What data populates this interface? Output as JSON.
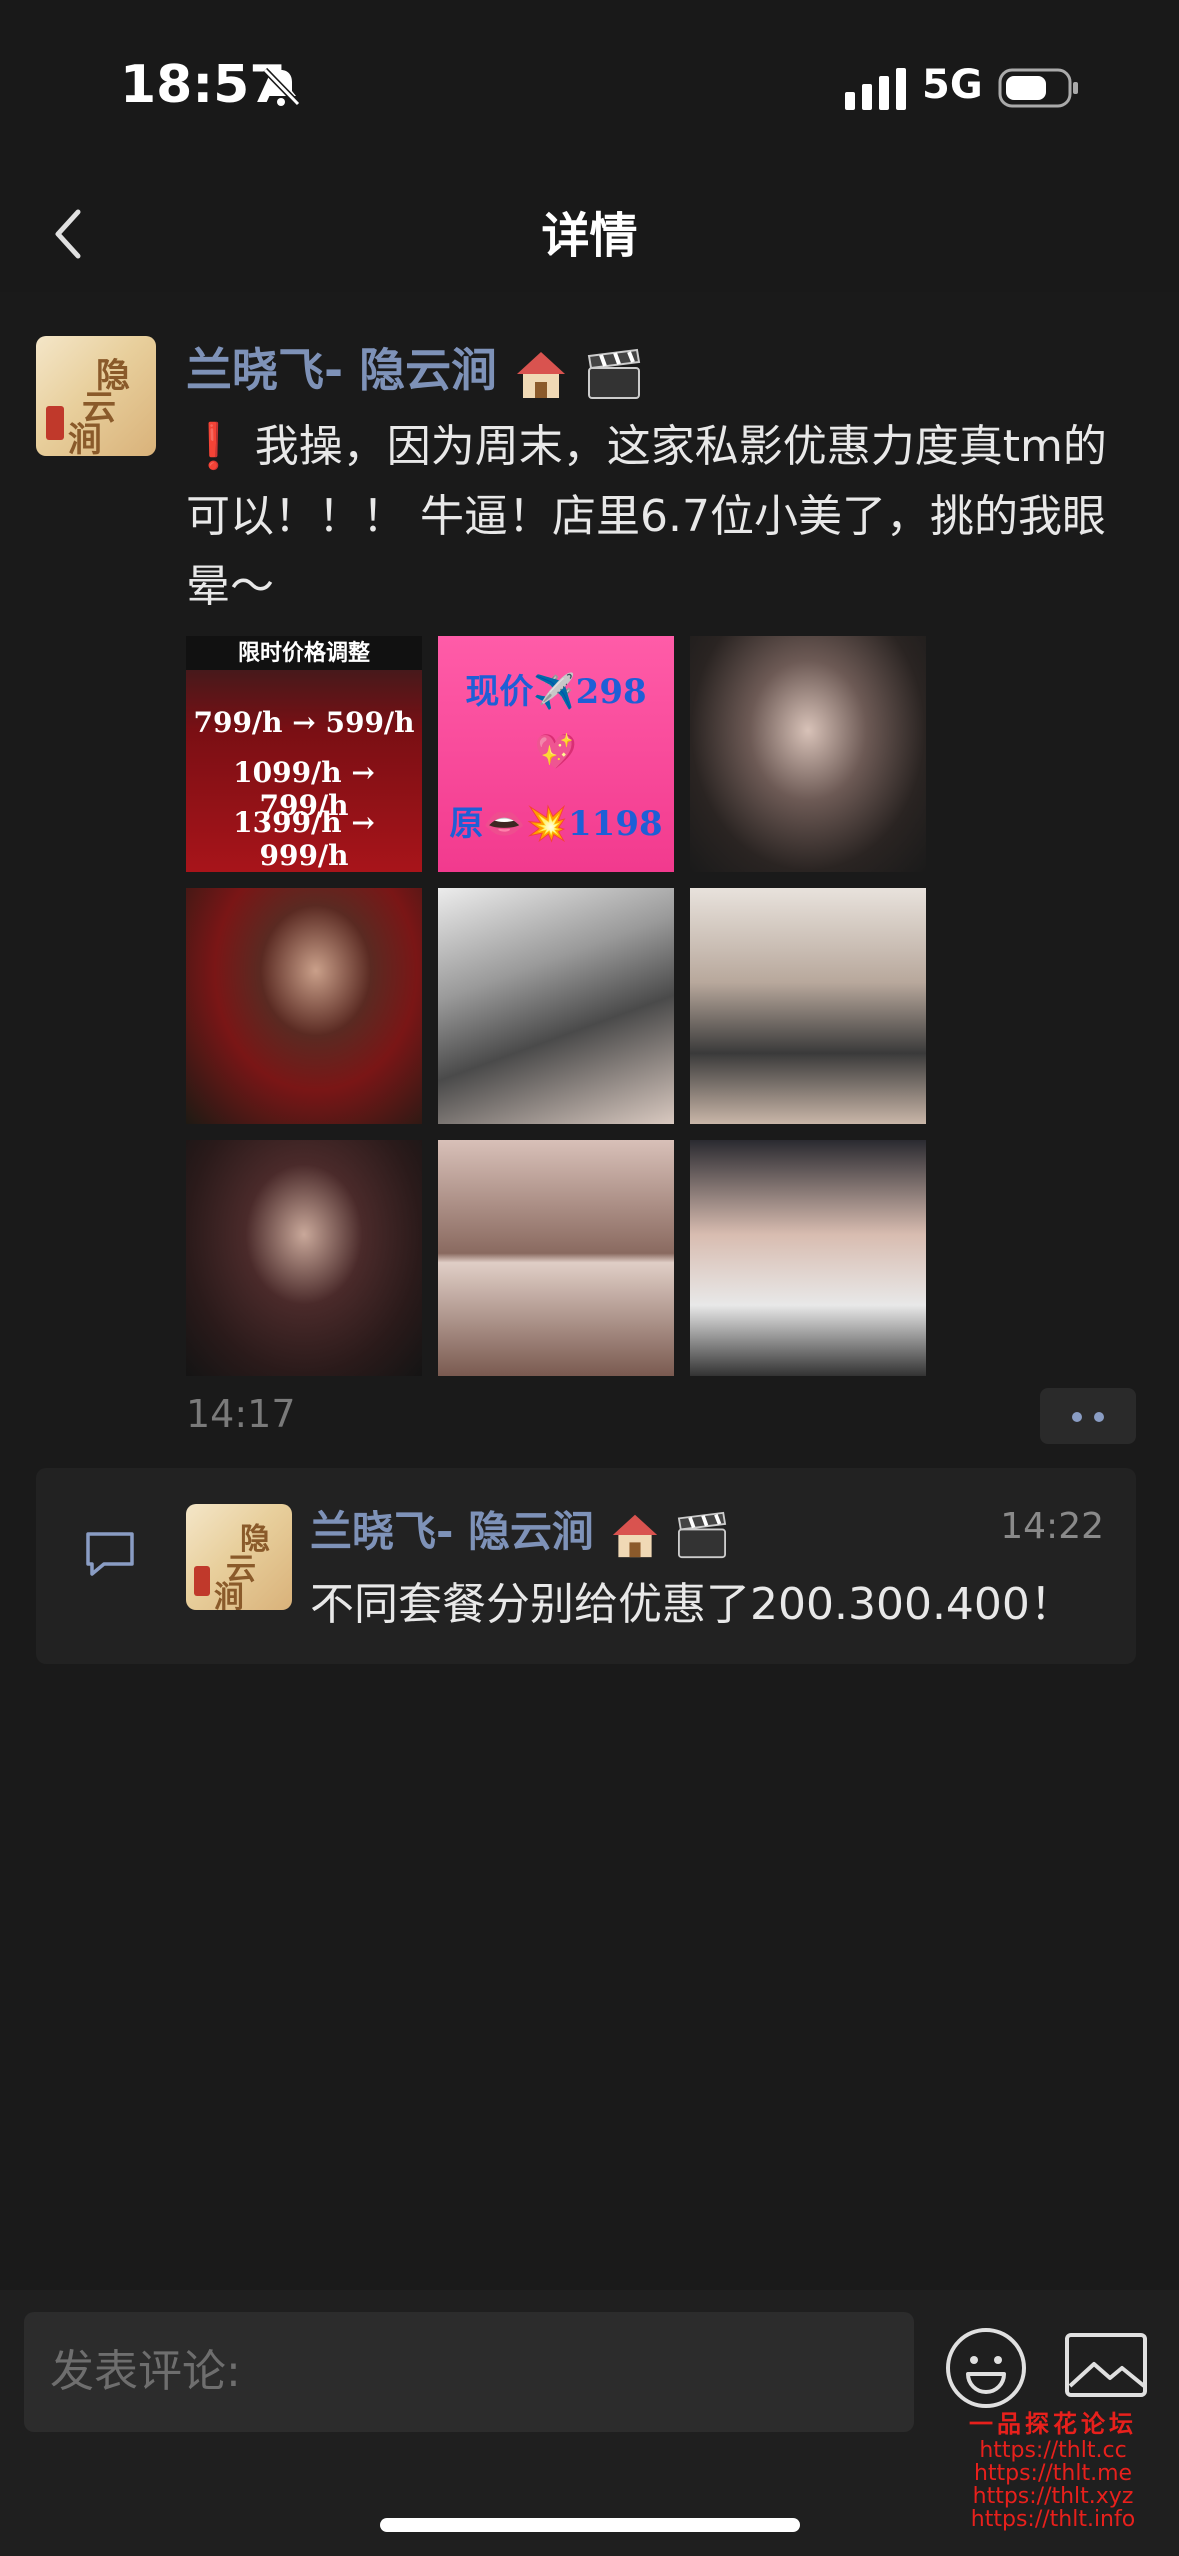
{
  "status_bar": {
    "time": "18:57",
    "network": "5G"
  },
  "nav": {
    "title": "详情"
  },
  "post": {
    "author": "兰晓飞- 隐云涧",
    "avatar_text": "隐云涧",
    "text_excl": "❗",
    "text": "我操，因为周末，这家私影优惠力度真tm的可以！！！ 牛逼！店里6.7位小美了，挑的我眼晕～",
    "time": "14:17",
    "images": [
      {
        "kind": "price-poster",
        "title": "限时价格调整",
        "lines": [
          "799/h → 599/h",
          "1099/h → 799/h",
          "1399/h → 999/h"
        ]
      },
      {
        "kind": "pink-poster",
        "lines": [
          "现价✈️298",
          "💖",
          "原👄💥1198"
        ]
      },
      {
        "kind": "photo"
      },
      {
        "kind": "photo"
      },
      {
        "kind": "photo"
      },
      {
        "kind": "photo"
      },
      {
        "kind": "photo"
      },
      {
        "kind": "photo"
      },
      {
        "kind": "photo"
      }
    ]
  },
  "comment": {
    "author": "兰晓飞- 隐云涧",
    "time": "14:22",
    "text": "不同套餐分别给优惠了200.300.400！"
  },
  "bottom": {
    "input_placeholder": "发表评论:",
    "watermark_title": "一品探花论坛",
    "watermark_urls": [
      "https://thlt.cc",
      "https://thlt.me",
      "https://thlt.xyz",
      "https://thlt.info"
    ]
  },
  "colors": {
    "name": "#7e92b8",
    "background": "#1a1a1a",
    "accent_red": "#e02020"
  }
}
